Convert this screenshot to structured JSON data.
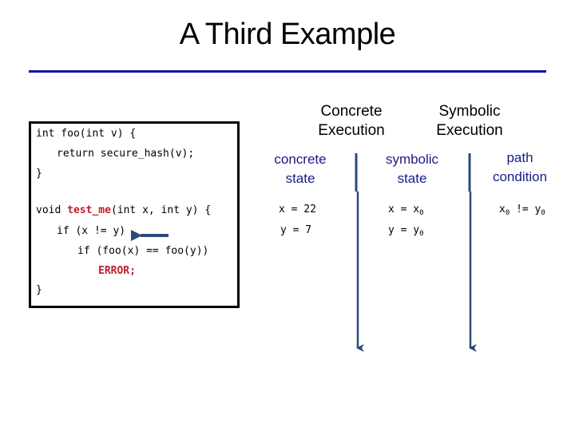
{
  "title": "A Third Example",
  "code": {
    "line1": "int foo(int v) {",
    "line2": "return secure_hash(v);",
    "line3": "}",
    "line4_prefix": "void ",
    "line4_func": "test_me",
    "line4_suffix": "(int x, int y) {",
    "line5": "if (x != y)",
    "line6": "if (foo(x) == foo(y))",
    "line7": "ERROR;",
    "line8": "}"
  },
  "columns": {
    "concrete_execution": {
      "line1": "Concrete",
      "line2": "Execution"
    },
    "symbolic_execution": {
      "line1": "Symbolic",
      "line2": "Execution"
    }
  },
  "subcolumns": {
    "concrete_state": {
      "line1": "concrete",
      "line2": "state"
    },
    "symbolic_state": {
      "line1": "symbolic",
      "line2": "state"
    },
    "path_condition": {
      "line1": "path",
      "line2": "condition"
    }
  },
  "values": {
    "concrete": {
      "x": "x = 22",
      "y": "y = 7"
    },
    "symbolic": {
      "x_lhs": "x = x",
      "x_sub": "0",
      "y_lhs": "y = y",
      "y_sub": "0"
    },
    "path": {
      "a": "x",
      "a_sub": "0",
      "op": " != y",
      "b_sub": "0"
    }
  },
  "colors": {
    "accent_rule": "#1010a0",
    "arrow": "#2a4a7a",
    "highlight_red": "#c0202a",
    "subheading": "#1a1a8a"
  }
}
